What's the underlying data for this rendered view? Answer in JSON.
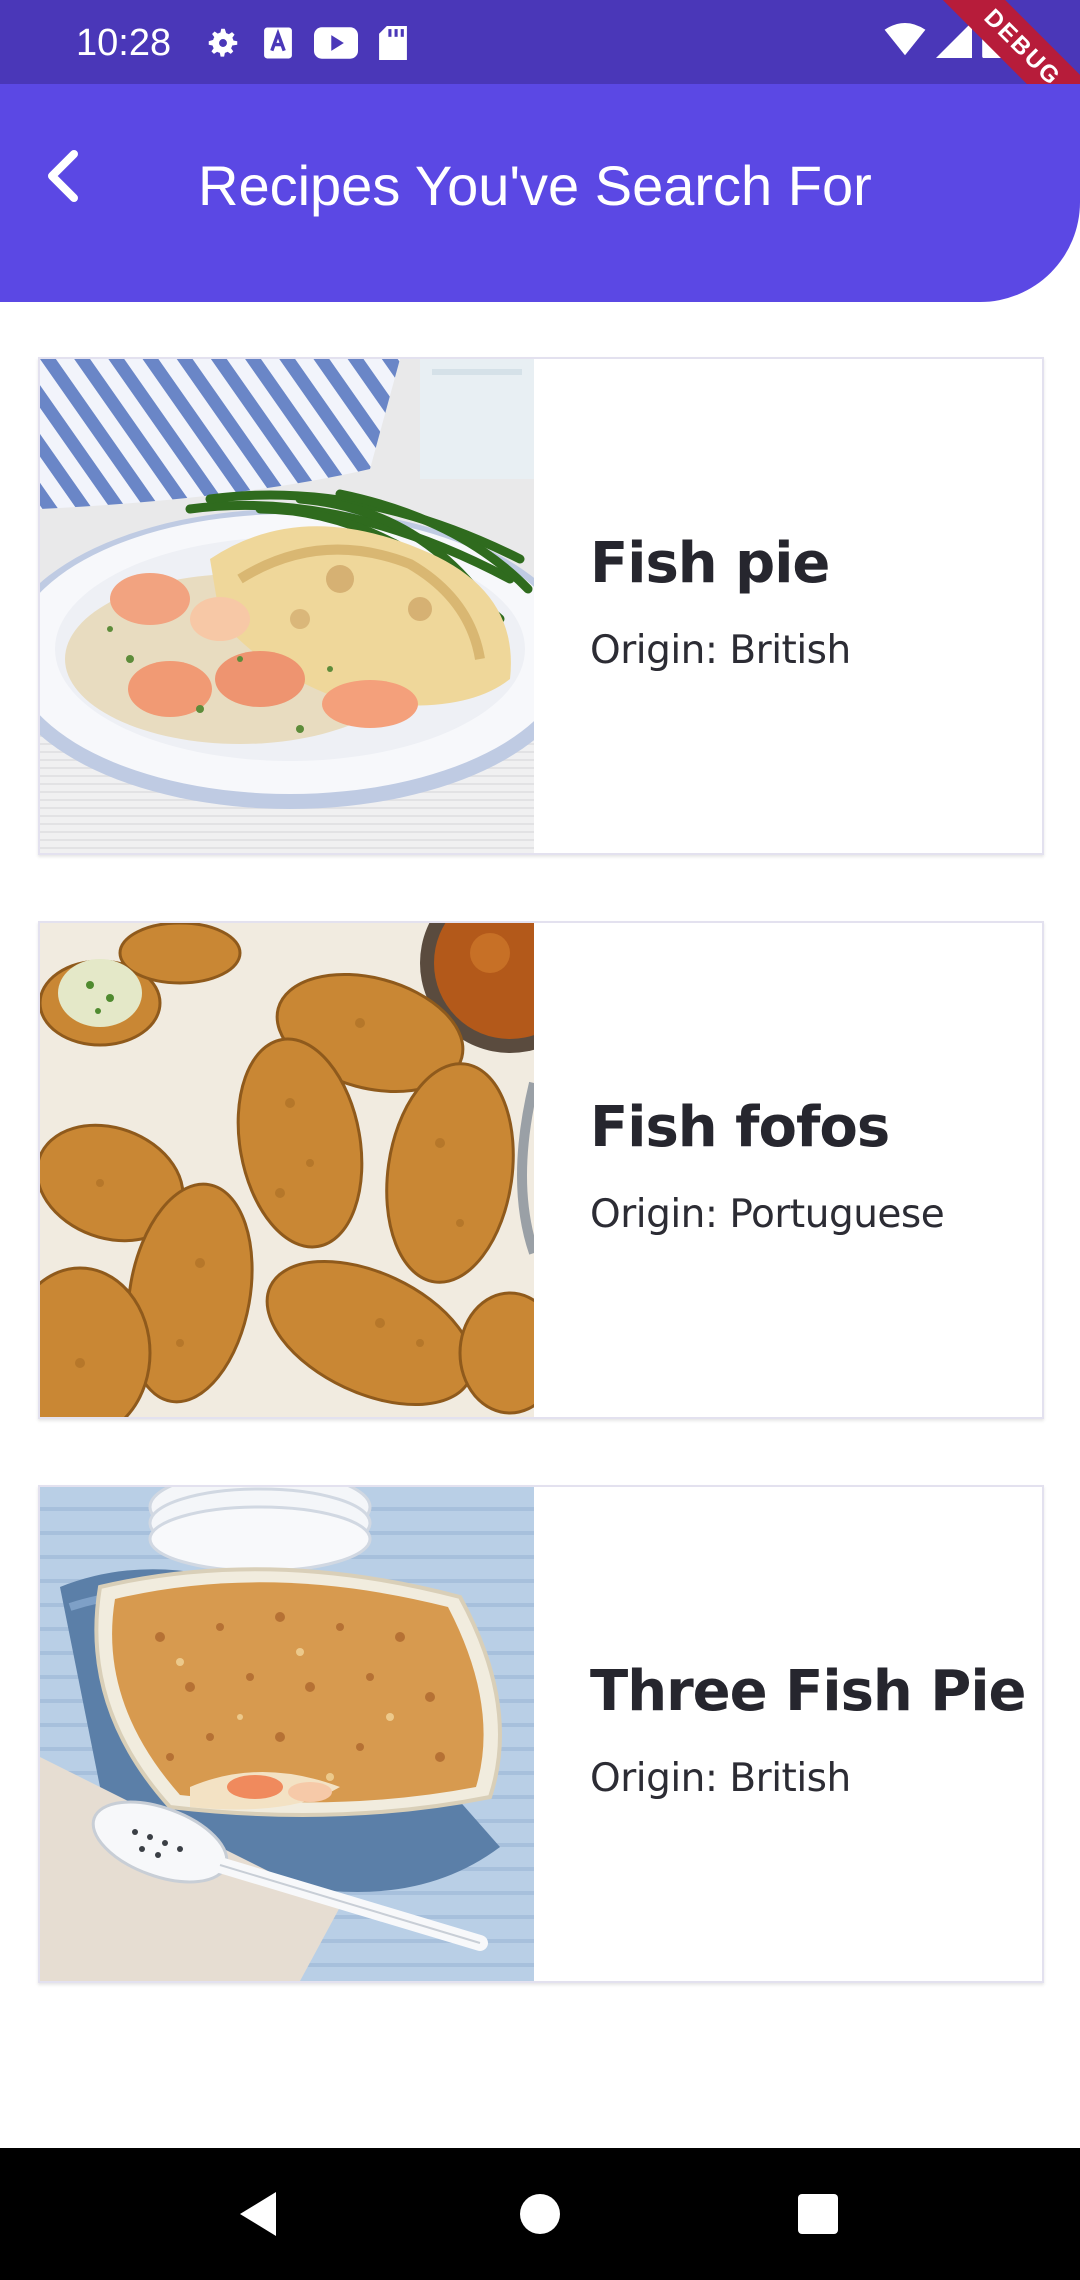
{
  "status_bar": {
    "time": "10:28",
    "left_icons": [
      "settings-icon",
      "a-box-icon",
      "youtube-icon",
      "sd-card-icon"
    ],
    "right_icons": [
      "wifi-icon",
      "signal-icon",
      "battery-icon"
    ],
    "debug_banner": "DEBUG"
  },
  "app_bar": {
    "title": "Recipes You've Search For",
    "back_icon": "chevron-left-icon",
    "color": "#5b48e4"
  },
  "recipes": [
    {
      "name": "Fish pie",
      "origin": "Origin: British",
      "image": "fish-pie-photo"
    },
    {
      "name": "Fish fofos",
      "origin": "Origin: Portuguese",
      "image": "fish-fofos-photo"
    },
    {
      "name": "Three Fish Pie",
      "origin": "Origin: British",
      "image": "three-fish-pie-photo"
    }
  ],
  "nav_bar": {
    "buttons": [
      "back-triangle-icon",
      "home-circle-icon",
      "recents-square-icon"
    ]
  }
}
